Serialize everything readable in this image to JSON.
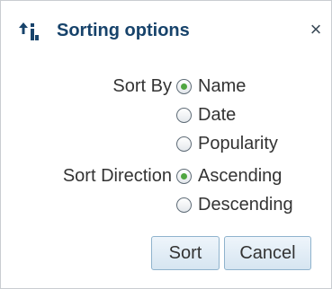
{
  "dialog": {
    "title": "Sorting options",
    "title_icon": "sort-icon",
    "close_label": "×"
  },
  "sort_by": {
    "label": "Sort By",
    "options": [
      {
        "label": "Name",
        "checked": true
      },
      {
        "label": "Date",
        "checked": false
      },
      {
        "label": "Popularity",
        "checked": false
      }
    ]
  },
  "sort_direction": {
    "label": "Sort Direction",
    "options": [
      {
        "label": "Ascending",
        "checked": true
      },
      {
        "label": "Descending",
        "checked": false
      }
    ]
  },
  "buttons": {
    "sort_label": "Sort",
    "cancel_label": "Cancel"
  },
  "colors": {
    "title": "#17436b",
    "radio_selected": "#4fa640",
    "button_border": "#8fb3cd"
  }
}
